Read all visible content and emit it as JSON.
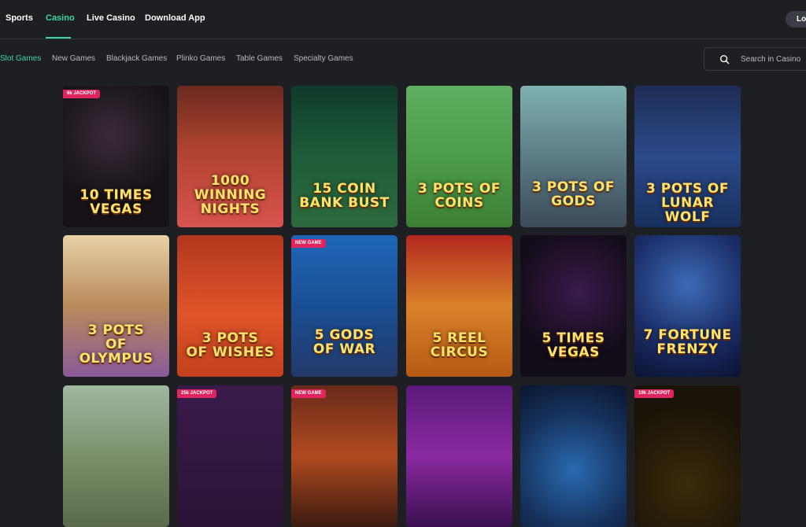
{
  "nav": {
    "items": [
      "Sports",
      "Casino",
      "Live Casino",
      "Download App"
    ],
    "active": "Casino",
    "login_label": "Lo"
  },
  "categories": [
    "Slot Games",
    "New Games",
    "Blackjack Games",
    "Plinko Games",
    "Table Games",
    "Specialty Games"
  ],
  "search": {
    "placeholder": "Search in Casino"
  },
  "colors": {
    "accent": "#3fd6a4",
    "background": "#1e1f23",
    "badge_jackpot": "#e0245e",
    "badge_new": "#e0245e"
  },
  "games": [
    {
      "title": "10 TIMES\nVEGAS",
      "badge": "6k JACKPOT"
    },
    {
      "title": "1000\nWINNING\nNIGHTS",
      "badge": ""
    },
    {
      "title": "15 COIN\nBANK BUST",
      "badge": ""
    },
    {
      "title": "3 POTS OF\nCOINS",
      "badge": ""
    },
    {
      "title": "3 POTS OF\nGODS",
      "badge": ""
    },
    {
      "title": "3 POTS OF\nLUNAR WOLF",
      "badge": ""
    },
    {
      "title": "3 POTS\nOF\nOLYMPUS",
      "badge": ""
    },
    {
      "title": "3 POTS\nOF WISHES",
      "badge": ""
    },
    {
      "title": "5 GODS\nOF WAR",
      "badge": "NEW GAME"
    },
    {
      "title": "5 REEL\nCIRCUS",
      "badge": ""
    },
    {
      "title": "5 TIMES\nVEGAS",
      "badge": ""
    },
    {
      "title": "7 FORTUNE\nFRENZY",
      "badge": ""
    },
    {
      "title": "",
      "badge": ""
    },
    {
      "title": "",
      "badge": "25k JACKPOT"
    },
    {
      "title": "",
      "badge": "NEW GAME"
    },
    {
      "title": "",
      "badge": ""
    },
    {
      "title": "",
      "badge": ""
    },
    {
      "title": "",
      "badge": "19k JACKPOT"
    }
  ]
}
